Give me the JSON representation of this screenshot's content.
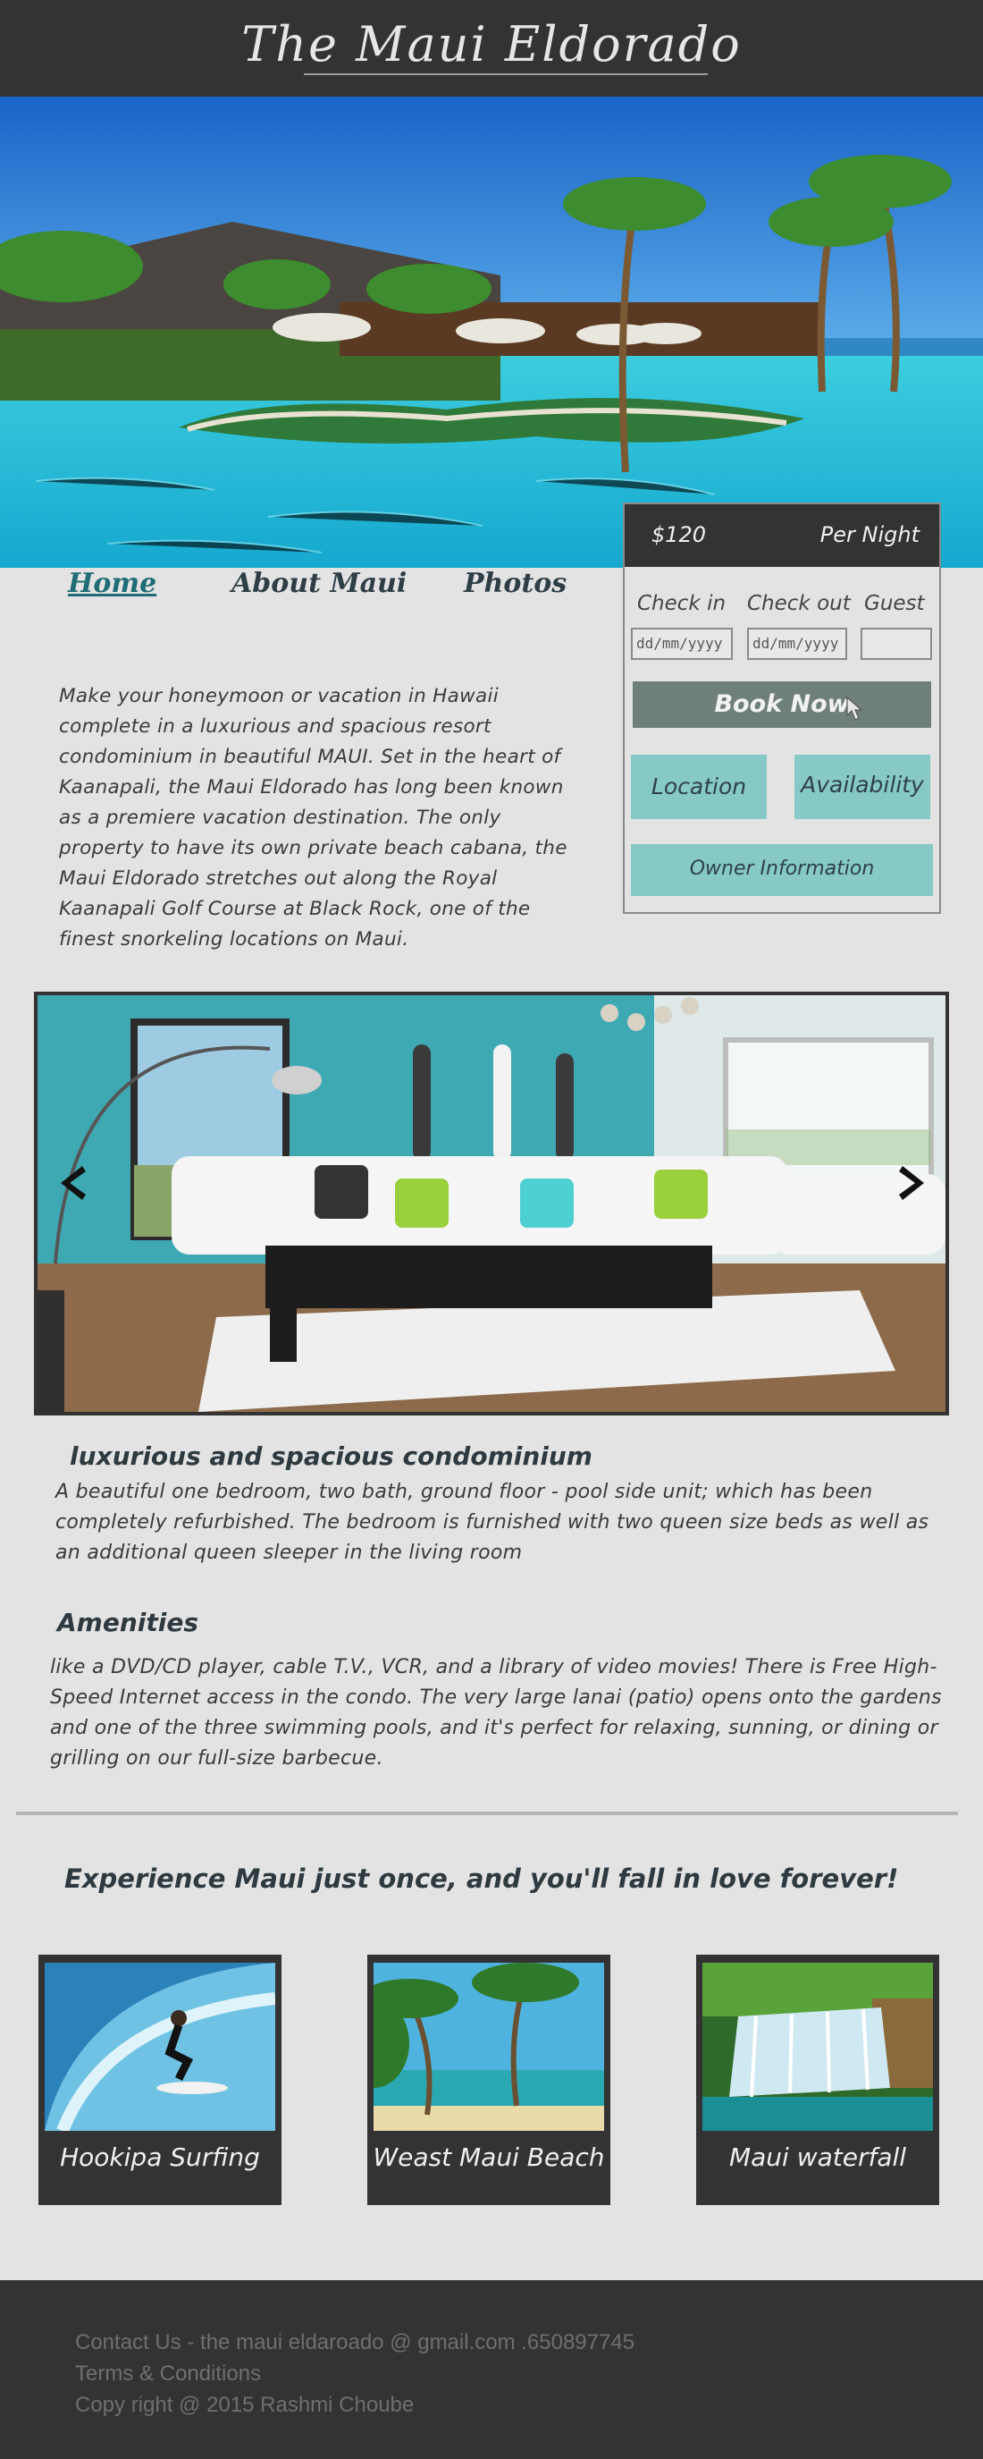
{
  "header": {
    "title": "The Maui Eldorado"
  },
  "nav": {
    "home": "Home",
    "about": "About Maui",
    "photos": "Photos"
  },
  "booking": {
    "price": "$120",
    "per_night": "Per Night",
    "check_in_label": "Check in",
    "check_out_label": "Check out",
    "guest_label": "Guest",
    "check_in_placeholder": "dd/mm/yyyy",
    "check_out_placeholder": "dd/mm/yyyy",
    "book_now": "Book Now",
    "location": "Location",
    "availability": "Availability",
    "owner_info": "Owner Information"
  },
  "intro": "Make your honeymoon or vacation in Hawaii complete in a luxurious and spacious resort condominium in beautiful MAUI. Set in the heart of Kaanapali, the Maui Eldorado has long been known as a premiere vacation destination. The only property to have its own private beach cabana, the Maui Eldorado stretches out along the Royal Kaanapali Golf Course at Black Rock, one of the finest snorkeling locations on Maui.",
  "condo": {
    "heading": "luxurious and spacious condominium",
    "text": "A beautiful one bedroom, two bath, ground floor - pool side unit; which has been completely refurbished. The bedroom is furnished with two queen size beds as well as an additional queen sleeper in the living room"
  },
  "amenities": {
    "heading": "Amenities",
    "text": "like a DVD/CD player, cable T.V., VCR, and a library of video movies! There is Free High-Speed Internet access in the condo. The very large lanai (patio) opens onto the gardens and one of the three swimming pools, and it's perfect for relaxing, sunning, or dining or grilling on our full-size barbecue."
  },
  "tagline": "Experience Maui just once, and you'll fall in love forever!",
  "cards": [
    {
      "caption": "Hookipa Surfing"
    },
    {
      "caption": "Weast Maui Beach"
    },
    {
      "caption": "Maui waterfall"
    }
  ],
  "footer": {
    "contact": "Contact Us - the maui eldaroado @ gmail.com .650897745",
    "terms": "Terms & Conditions",
    "copyright": "Copy right @ 2015 Rashmi Choube"
  },
  "colors": {
    "dark": "#333333",
    "teal": "#86c9c7",
    "book_button": "#6f807c",
    "page_bg": "#e3e3e3"
  },
  "icons": [
    "cursor-icon",
    "chevron-left-icon",
    "chevron-right-icon"
  ]
}
